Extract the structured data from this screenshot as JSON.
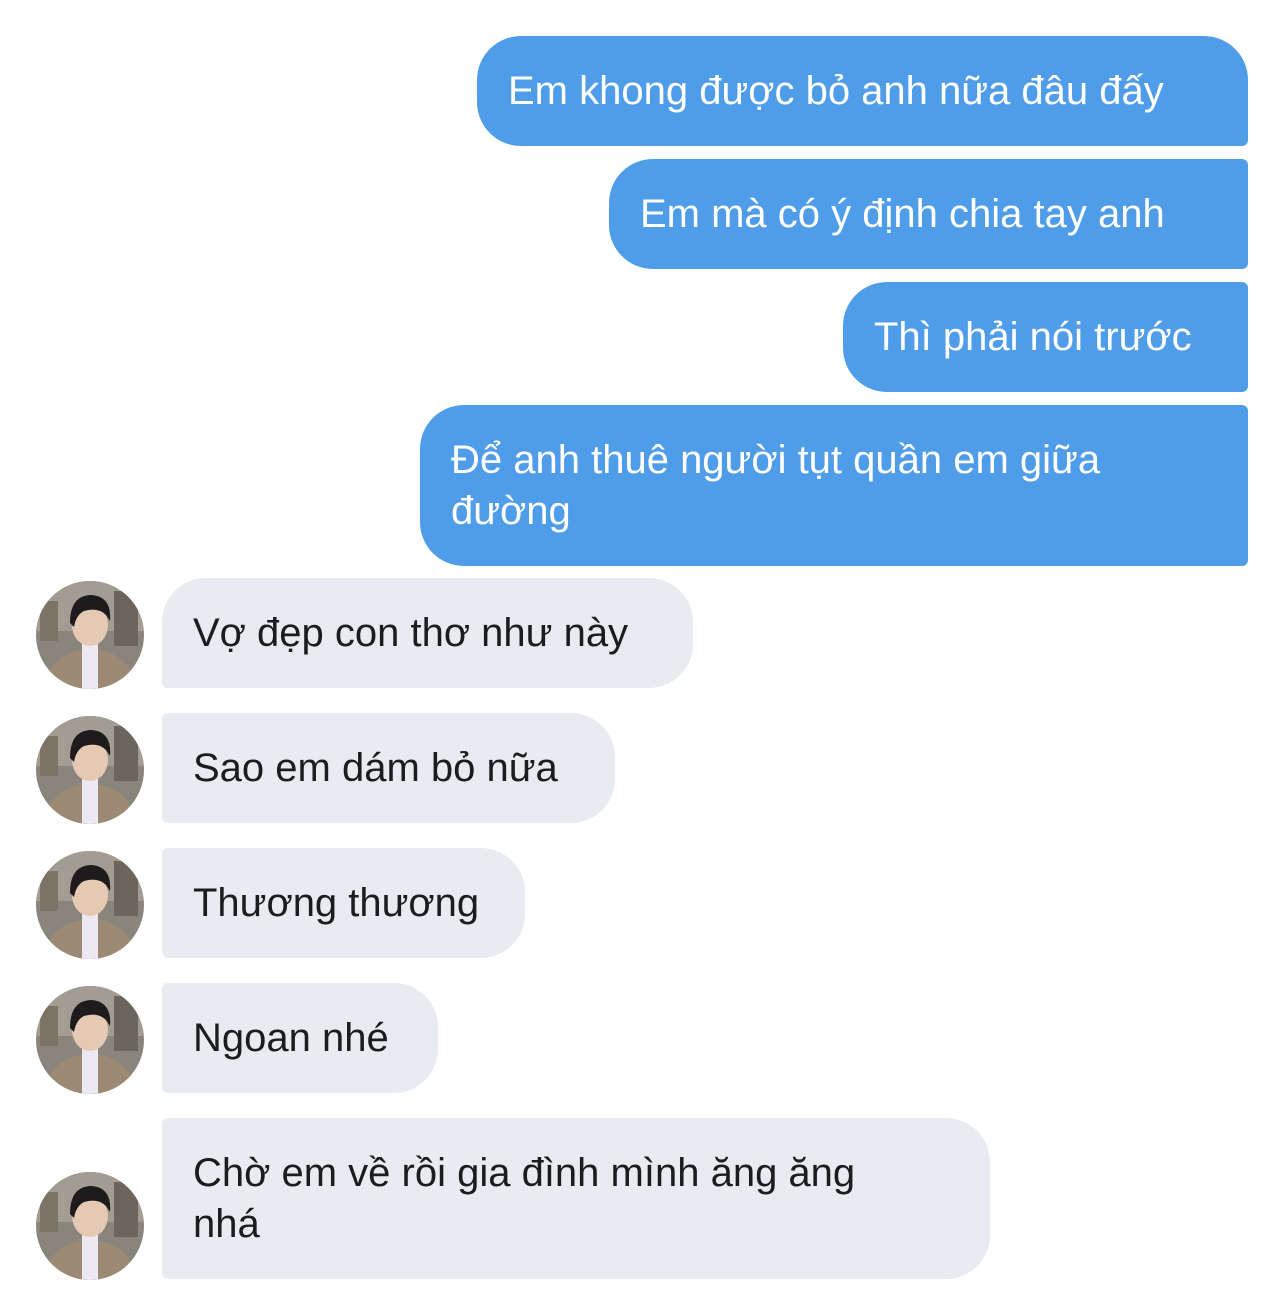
{
  "colors": {
    "outgoing_bubble": "#4f9de9",
    "outgoing_text": "#ffffff",
    "incoming_bubble": "#e8ebef",
    "incoming_text": "#1c1c1e"
  },
  "outgoing_messages": [
    {
      "text": "Em khong được bỏ anh nữa đâu đấy"
    },
    {
      "text": "Em mà có ý định chia tay anh"
    },
    {
      "text": "Thì phải nói trước"
    },
    {
      "text": "Để anh thuê người tụt quần em giữa đường"
    }
  ],
  "incoming_messages": [
    {
      "text": "Vợ đẹp con thơ như này",
      "avatar": "contact-avatar-photo"
    },
    {
      "text": "Sao em dám bỏ nữa",
      "avatar": "contact-avatar-photo"
    },
    {
      "text": "Thương thương",
      "avatar": "contact-avatar-photo"
    },
    {
      "text": "Ngoan nhé",
      "avatar": "contact-avatar-photo"
    },
    {
      "text": "Chờ em về rồi gia đình mình ăng ăng nhá",
      "avatar": "contact-avatar-photo"
    }
  ]
}
